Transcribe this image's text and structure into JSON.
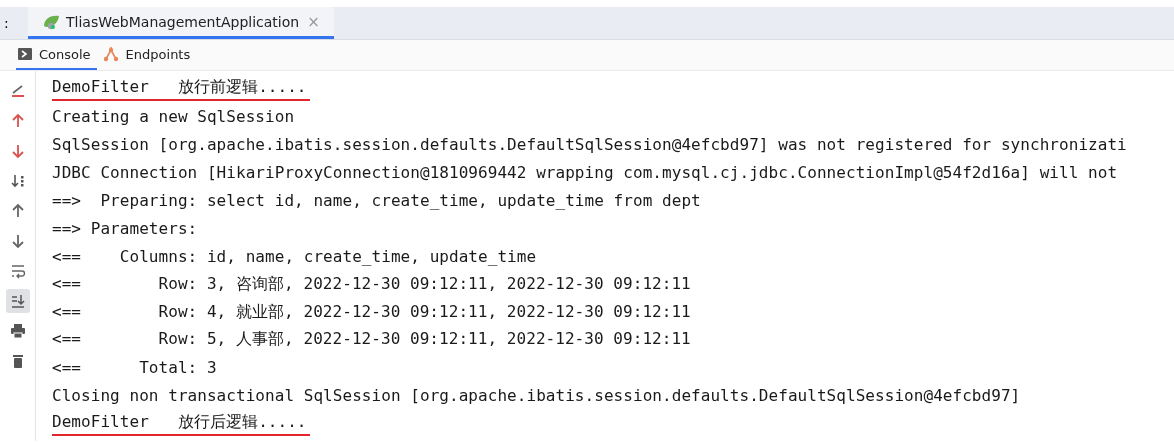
{
  "run_tabs": {
    "prefix": ":",
    "tabs": [
      {
        "label": "TliasWebManagementApplication",
        "close": "×",
        "selected": true
      }
    ]
  },
  "view_tabs": [
    {
      "label": "Console",
      "selected": true
    },
    {
      "label": "Endpoints",
      "selected": false
    }
  ],
  "gutter_tools": [
    {
      "selected": false
    },
    {
      "selected": false
    },
    {
      "selected": false
    },
    {
      "selected": false
    },
    {
      "selected": false
    },
    {
      "selected": false
    },
    {
      "selected": false
    },
    {
      "selected": true
    },
    {
      "selected": false
    },
    {
      "selected": false
    }
  ],
  "console_lines": [
    {
      "text": "DemoFilter   放行前逻辑.....",
      "underlined": true
    },
    {
      "text": "Creating a new SqlSession",
      "underlined": false
    },
    {
      "text": "SqlSession [org.apache.ibatis.session.defaults.DefaultSqlSession@4efcbd97] was not registered for synchronizati",
      "underlined": false
    },
    {
      "text": "JDBC Connection [HikariProxyConnection@1810969442 wrapping com.mysql.cj.jdbc.ConnectionImpl@54f2d16a] will not",
      "underlined": false
    },
    {
      "text": "==>  Preparing: select id, name, create_time, update_time from dept",
      "underlined": false
    },
    {
      "text": "==> Parameters: ",
      "underlined": false
    },
    {
      "text": "<==    Columns: id, name, create_time, update_time",
      "underlined": false
    },
    {
      "text": "<==        Row: 3, 咨询部, 2022-12-30 09:12:11, 2022-12-30 09:12:11",
      "underlined": false
    },
    {
      "text": "<==        Row: 4, 就业部, 2022-12-30 09:12:11, 2022-12-30 09:12:11",
      "underlined": false
    },
    {
      "text": "<==        Row: 5, 人事部, 2022-12-30 09:12:11, 2022-12-30 09:12:11",
      "underlined": false
    },
    {
      "text": "<==      Total: 3",
      "underlined": false
    },
    {
      "text": "Closing non transactional SqlSession [org.apache.ibatis.session.defaults.DefaultSqlSession@4efcbd97]",
      "underlined": false
    },
    {
      "text": "DemoFilter   放行后逻辑.....",
      "underlined": true
    }
  ]
}
